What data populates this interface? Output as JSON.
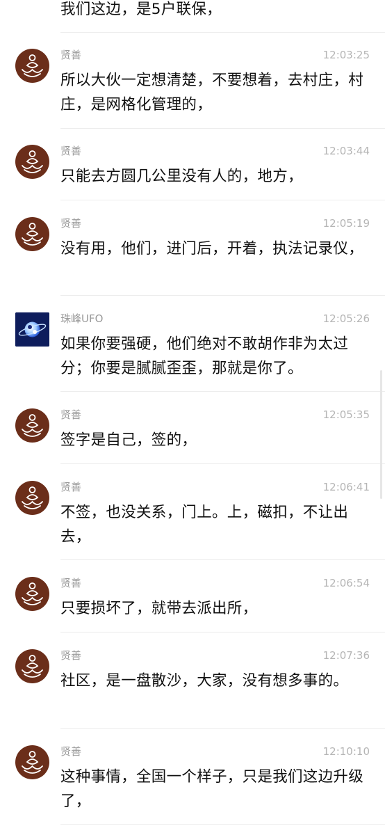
{
  "top_fragment": "我们这边，是5户联保，",
  "messages": [
    {
      "sender": "贤善",
      "time": "12:03:25",
      "text": "所以大伙一定想清楚，不要想着，去村庄，村庄，是网格化管理的，",
      "avatar": "lotus-buddha-avatar"
    },
    {
      "sender": "贤善",
      "time": "12:03:44",
      "text": "只能去方圆几公里没有人的，地方，",
      "avatar": "lotus-buddha-avatar"
    },
    {
      "sender": "贤善",
      "time": "12:05:19",
      "text": "没有用，他们，进门后，开着，执法记录仪，",
      "avatar": "lotus-buddha-avatar"
    },
    {
      "sender": "珠峰UFO",
      "time": "12:05:26",
      "text": "如果你要强硬，他们绝对不敢胡作非为太过分；你要是腻腻歪歪，那就是你了。",
      "avatar": "ufo-planet-avatar"
    },
    {
      "sender": "贤善",
      "time": "12:05:35",
      "text": "签字是自己，签的，",
      "avatar": "lotus-buddha-avatar"
    },
    {
      "sender": "贤善",
      "time": "12:06:41",
      "text": "不签，也没关系，门上。上，磁扣，不让出去，",
      "avatar": "lotus-buddha-avatar"
    },
    {
      "sender": "贤善",
      "time": "12:06:54",
      "text": "只要损坏了，就带去派出所，",
      "avatar": "lotus-buddha-avatar"
    },
    {
      "sender": "贤善",
      "time": "12:07:36",
      "text": "社区，是一盘散沙，大家，没有想多事的。",
      "avatar": "lotus-buddha-avatar"
    },
    {
      "sender": "贤善",
      "time": "12:10:10",
      "text": "这种事情，全国一个样子，只是我们这边升级了，",
      "avatar": "lotus-buddha-avatar"
    }
  ],
  "colors": {
    "avatar_brown": "#6b2e1a",
    "avatar_ufo_bg": "#0e1d5c",
    "sender_gray": "#9a9a9a",
    "time_gray": "#b5b5b5",
    "text": "#111111"
  }
}
